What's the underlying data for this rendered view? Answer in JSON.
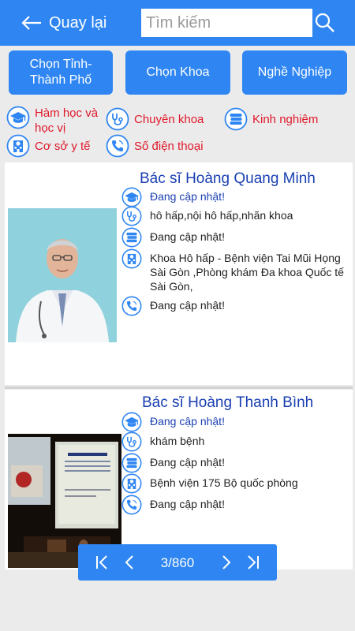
{
  "header": {
    "back_label": "Quay lại",
    "search_placeholder": "Tìm kiếm"
  },
  "filters": {
    "city": "Chọn Tỉnh-Thành Phố",
    "department": "Chọn Khoa",
    "profession": "Nghề Nghiệp"
  },
  "legend": {
    "degree": "Hàm học và học vị",
    "specialty": "Chuyên khoa",
    "experience": "Kinh nghiệm",
    "facility": "Cơ sở y tế",
    "phone": "Số điện thoại"
  },
  "doctors": [
    {
      "name": "Bác sĩ  Hoàng Quang Minh",
      "degree": "Đang cập nhật!",
      "specialty": "hô hấp,nội hô hấp,nhãn khoa",
      "experience": "Đang cập nhật!",
      "facility": "Khoa Hô hấp - Bệnh viện Tai Mũi Họng Sài Gòn ,Phòng khám Đa khoa Quốc tế Sài Gòn,",
      "phone": "Đang cập nhật!"
    },
    {
      "name": "Bác sĩ  Hoàng Thanh Bình",
      "degree": "Đang cập nhật!",
      "specialty": "khám bệnh",
      "experience": "Đang cập nhật!",
      "facility": "Bệnh viện 175 Bộ quốc phòng",
      "phone": "Đang cập nhật!"
    }
  ],
  "pager": {
    "label": "3/860"
  },
  "colors": {
    "primary": "#2f86f2",
    "accent_red": "#e0182a",
    "name_blue": "#1a3fb2"
  }
}
